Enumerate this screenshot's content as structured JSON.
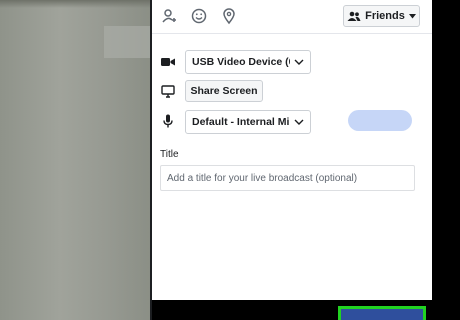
{
  "toolbar": {
    "icons": [
      "tag-person-icon",
      "emoji-icon",
      "location-pin-icon"
    ],
    "audience_button_label": "Friends"
  },
  "sources": {
    "camera_select_value": "USB Video Device (0...",
    "share_screen_label": "Share Screen",
    "microphone_select_value": "Default - Internal Mi..."
  },
  "broadcast": {
    "title_label": "Title",
    "title_placeholder": "Add a title for your live broadcast (optional)"
  },
  "colors": {
    "mic_level": "#c6d6f7",
    "go_live_button": "#2f4f9d",
    "highlight": "#21d321"
  }
}
